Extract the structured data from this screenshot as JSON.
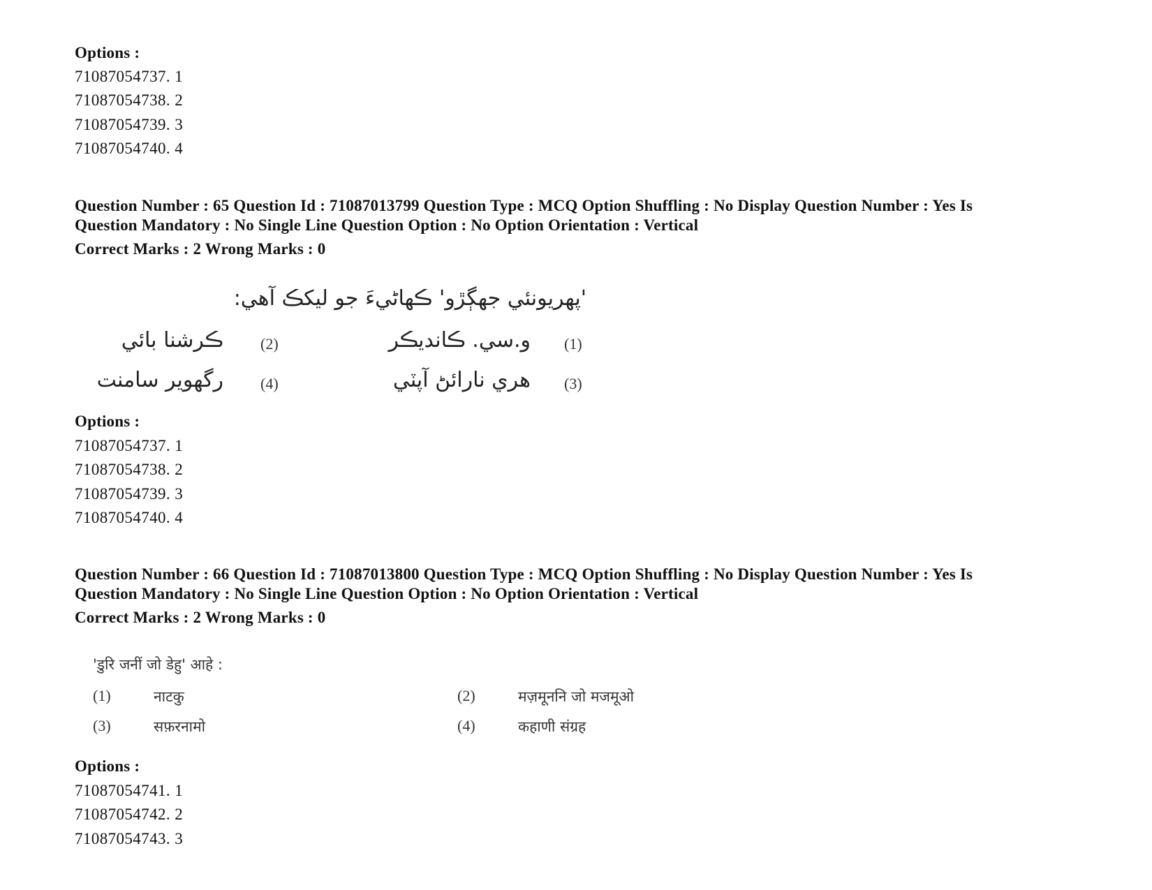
{
  "top_options": {
    "label": "Options :",
    "items": [
      "71087054737. 1",
      "71087054738. 2",
      "71087054739. 3",
      "71087054740. 4"
    ]
  },
  "q65": {
    "header_line1": "Question Number : 65 Question Id : 71087013799 Question Type : MCQ Option Shuffling : No Display Question Number : Yes Is",
    "header_line2": "Question Mandatory : No Single Line Question Option : No Option Orientation : Vertical",
    "marks": "Correct Marks : 2 Wrong Marks : 0",
    "question_text": "'پهريونئي جهڳڙو' ڪهاڻيءَ جو ليکڪ آهي:",
    "choices": [
      {
        "num": "(1)",
        "text": "و.سي. ڪانديڪر"
      },
      {
        "num": "(2)",
        "text": "ڪرشنا بائي"
      },
      {
        "num": "(3)",
        "text": "هري نارائڻ آپٽي"
      },
      {
        "num": "(4)",
        "text": "رگھوير سامنت"
      }
    ],
    "options_label": "Options :",
    "options": [
      "71087054737. 1",
      "71087054738. 2",
      "71087054739. 3",
      "71087054740. 4"
    ]
  },
  "q66": {
    "header_line1": "Question Number : 66 Question Id : 71087013800 Question Type : MCQ Option Shuffling : No Display Question Number : Yes Is",
    "header_line2": "Question Mandatory : No Single Line Question Option : No Option Orientation : Vertical",
    "marks": "Correct Marks : 2 Wrong Marks : 0",
    "question_text": "'डुरि जनीं जो डेहु' आहे :",
    "choices": [
      {
        "num": "(1)",
        "text": "नाटकु"
      },
      {
        "num": "(2)",
        "text": "मज़मूननि जो मजमूओ"
      },
      {
        "num": "(3)",
        "text": "सफ़रनामो"
      },
      {
        "num": "(4)",
        "text": "कहाणी संग्रह"
      }
    ],
    "options_label": "Options :",
    "options": [
      "71087054741. 1",
      "71087054742. 2",
      "71087054743. 3"
    ]
  }
}
